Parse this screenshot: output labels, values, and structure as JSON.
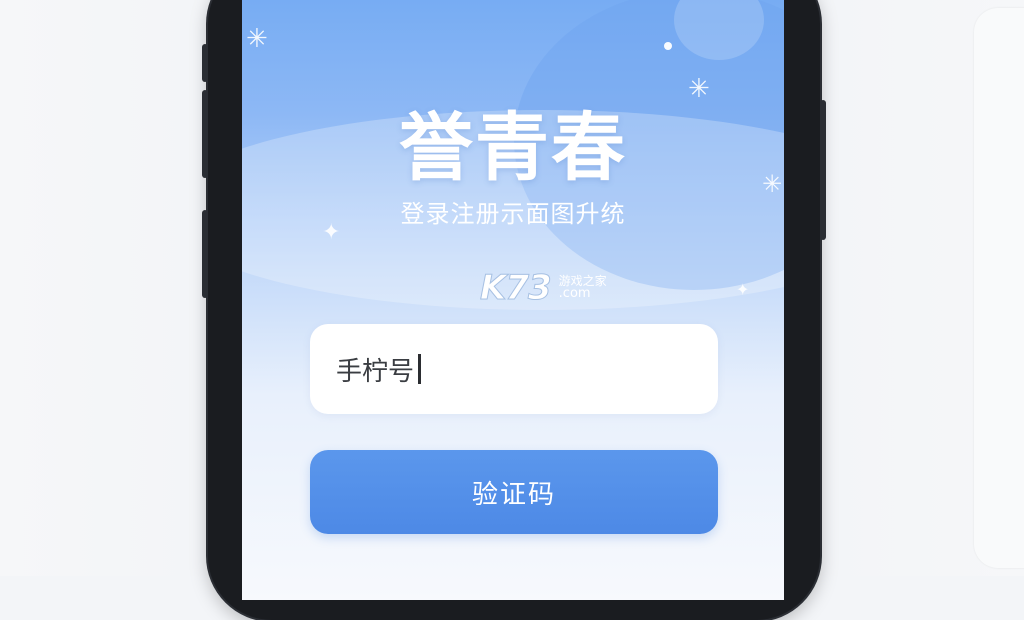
{
  "app": {
    "title": "誉青春",
    "subtitle": "登录注册示面图升统"
  },
  "watermark": {
    "logo": "K73",
    "name": "游戏之家",
    "url": ".com"
  },
  "login": {
    "phone_label": "手柠号",
    "code_button_label": "验证码"
  },
  "colors": {
    "accent": "#4d89e6",
    "header_blue": "#6fa8f2",
    "input_bg": "#ffffff"
  },
  "icons": [
    "sparkle-icon",
    "cursor-caret"
  ]
}
